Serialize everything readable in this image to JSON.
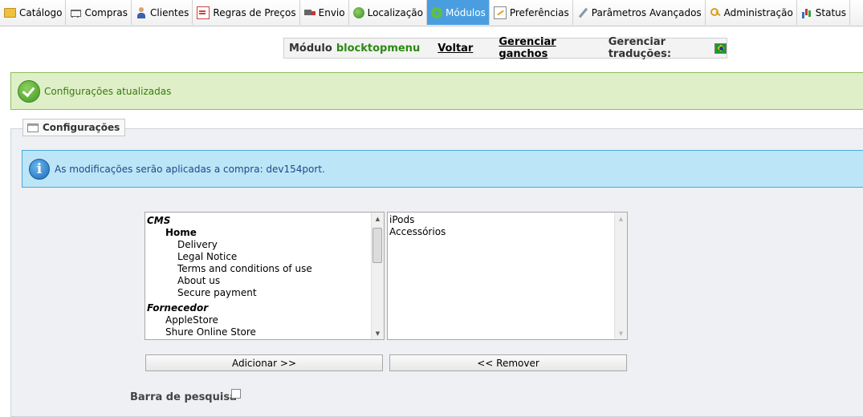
{
  "nav": {
    "tabs": [
      {
        "label": "Catálogo",
        "icon": "folder-icon"
      },
      {
        "label": "Compras",
        "icon": "cart-icon"
      },
      {
        "label": "Clientes",
        "icon": "user-icon"
      },
      {
        "label": "Regras de Preços",
        "icon": "price-rules-icon"
      },
      {
        "label": "Envio",
        "icon": "truck-icon"
      },
      {
        "label": "Localização",
        "icon": "globe-icon"
      },
      {
        "label": "Módulos",
        "icon": "gear-icon",
        "active": true
      },
      {
        "label": "Preferências",
        "icon": "preferences-icon"
      },
      {
        "label": "Parâmetros Avançados",
        "icon": "wrench-icon"
      },
      {
        "label": "Administração",
        "icon": "key-icon"
      },
      {
        "label": "Status",
        "icon": "stats-icon"
      }
    ]
  },
  "module_bar": {
    "label": "Módulo",
    "module_name": "blocktopmenu",
    "back": "Voltar",
    "hooks": "Gerenciar ganchos",
    "translations": "Gerenciar traduções:",
    "flag_icon": "brazil-flag-icon"
  },
  "success": {
    "message": "Configurações atualizadas"
  },
  "settings": {
    "legend": "Configurações",
    "info": "As modificações serão aplicadas a compra: dev154port.",
    "available_items": [
      {
        "text": "CMS",
        "kind": "group"
      },
      {
        "text": "Home",
        "kind": "sub"
      },
      {
        "text": "Delivery",
        "kind": "item"
      },
      {
        "text": "Legal Notice",
        "kind": "item"
      },
      {
        "text": "Terms and conditions of use",
        "kind": "item"
      },
      {
        "text": "About us",
        "kind": "item"
      },
      {
        "text": "Secure payment",
        "kind": "item"
      },
      {
        "text": "Fornecedor",
        "kind": "group"
      },
      {
        "text": "AppleStore",
        "kind": "sub-item"
      },
      {
        "text": "Shure Online Store",
        "kind": "sub-item"
      }
    ],
    "selected_items": [
      "iPods",
      "Accessórios"
    ],
    "add_label": "Adicionar >>",
    "remove_label": "<< Remover",
    "search_bar_label": "Barra de pesquisa"
  }
}
